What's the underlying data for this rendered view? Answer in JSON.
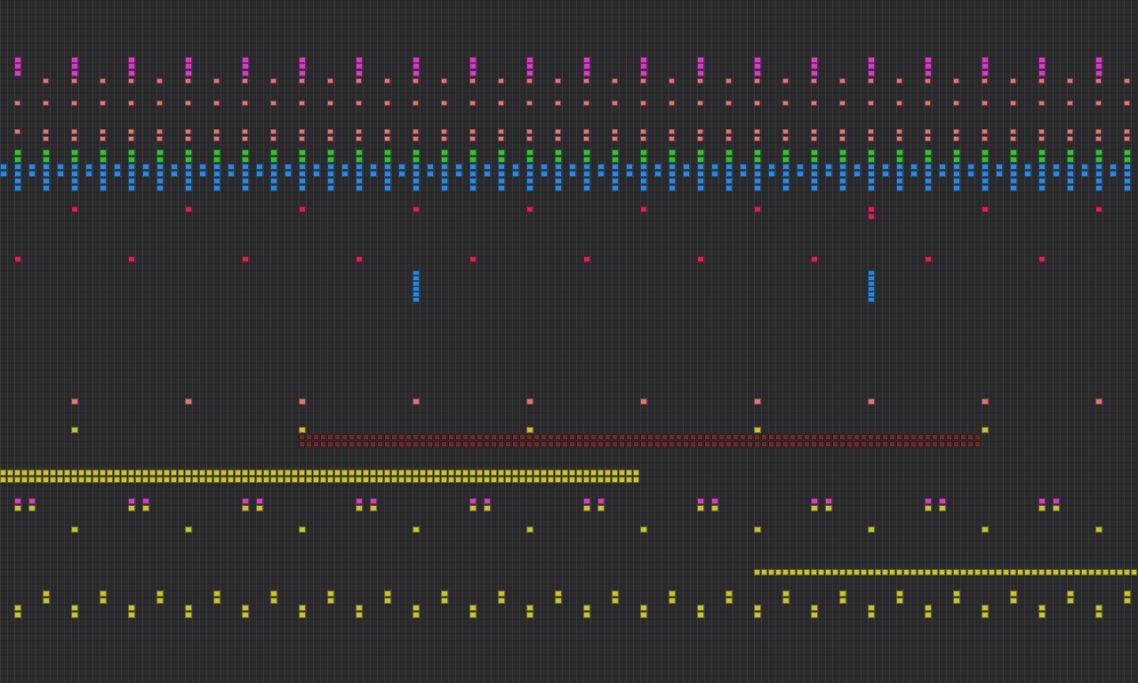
{
  "app": {
    "title": ""
  },
  "colors": {
    "background": "#2b2b2d",
    "grid_line": "#3a3a3c",
    "magenta": "#d23fc4",
    "salmon": "#e07878",
    "green": "#38c238",
    "blue": "#2f86d8",
    "crimson": "#d0245a",
    "olive": "#c8c234",
    "maroon": "#6a2c2c"
  },
  "tracks": [
    {
      "name": "track-magenta-chords",
      "color": "magenta",
      "label": ""
    },
    {
      "name": "track-salmon",
      "color": "salmon",
      "label": ""
    },
    {
      "name": "track-green",
      "color": "green",
      "label": ""
    },
    {
      "name": "track-blue",
      "color": "blue",
      "label": ""
    },
    {
      "name": "track-crimson",
      "color": "crimson",
      "label": ""
    },
    {
      "name": "track-olive",
      "color": "olive",
      "label": ""
    }
  ]
}
